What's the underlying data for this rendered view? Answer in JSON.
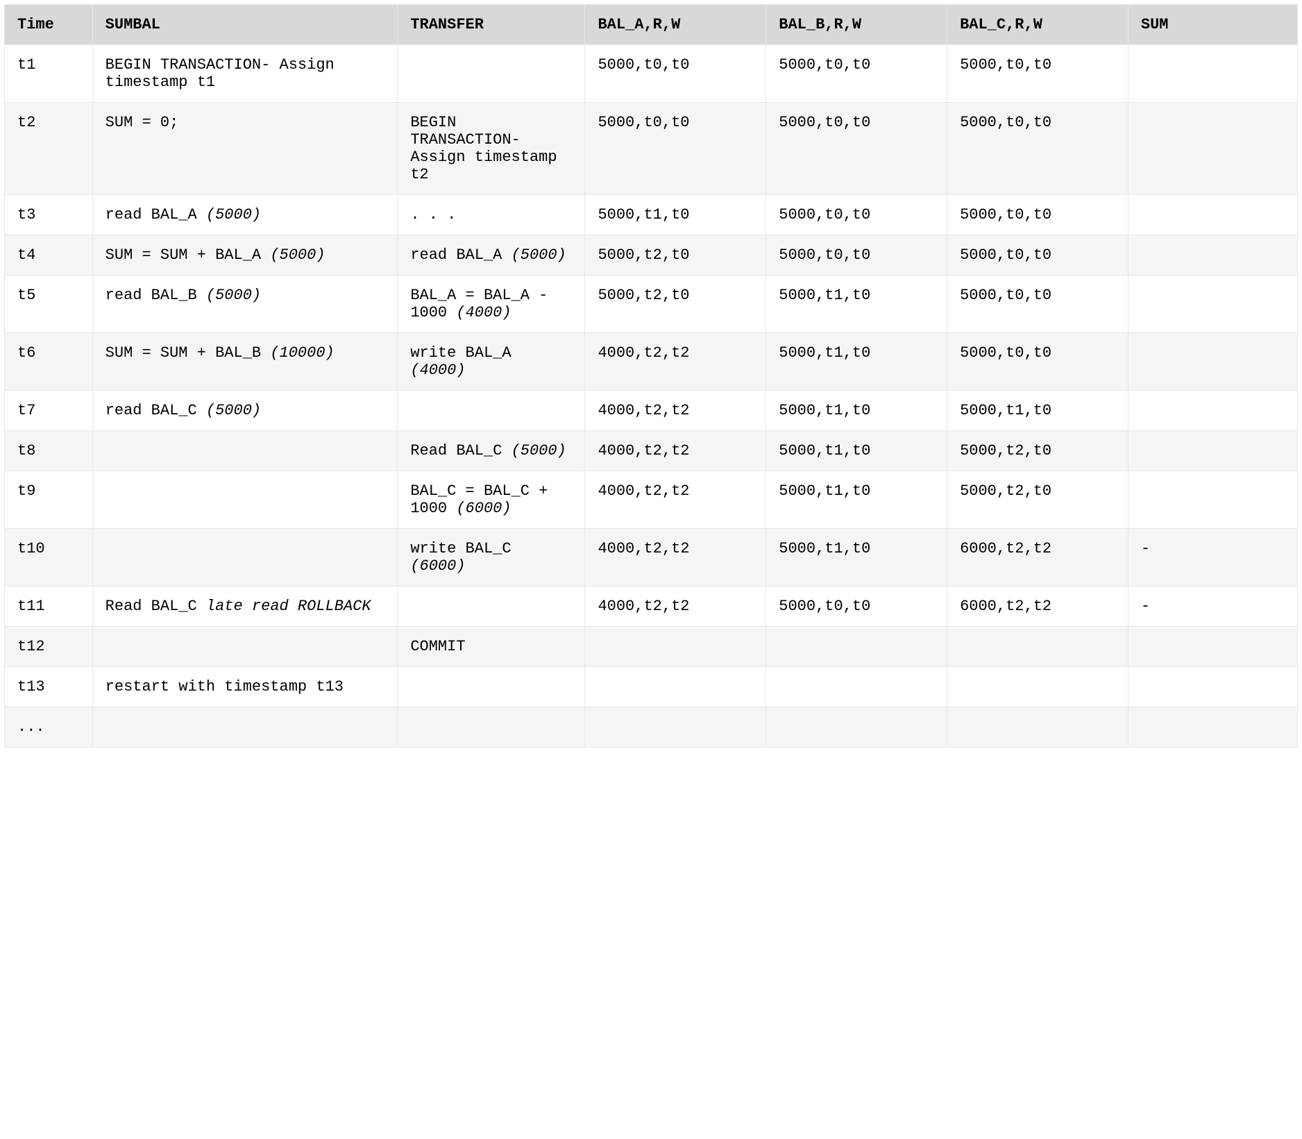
{
  "headers": [
    "Time",
    "SUMBAL",
    "TRANSFER",
    "BAL_A,R,W",
    "BAL_B,R,W",
    "BAL_C,R,W",
    "SUM"
  ],
  "rows": [
    {
      "time": "t1",
      "sumbal": [
        {
          "t": "BEGIN TRANSACTION- Assign timestamp t1",
          "i": false
        }
      ],
      "transfer": [],
      "bal_a": "5000,t0,t0",
      "bal_b": "5000,t0,t0",
      "bal_c": "5000,t0,t0",
      "sum": ""
    },
    {
      "time": "t2",
      "sumbal": [
        {
          "t": "SUM = 0;",
          "i": false
        }
      ],
      "transfer": [
        {
          "t": "BEGIN TRANSACTION- Assign timestamp t2",
          "i": false
        }
      ],
      "bal_a": "5000,t0,t0",
      "bal_b": "5000,t0,t0",
      "bal_c": "5000,t0,t0",
      "sum": ""
    },
    {
      "time": "t3",
      "sumbal": [
        {
          "t": "read BAL_A ",
          "i": false
        },
        {
          "t": "(5000)",
          "i": true
        }
      ],
      "transfer": [
        {
          "t": ". . .",
          "i": false
        }
      ],
      "bal_a": "5000,t1,t0",
      "bal_b": "5000,t0,t0",
      "bal_c": "5000,t0,t0",
      "sum": ""
    },
    {
      "time": "t4",
      "sumbal": [
        {
          "t": "SUM = SUM + BAL_A ",
          "i": false
        },
        {
          "t": "(5000)",
          "i": true
        }
      ],
      "transfer": [
        {
          "t": "read BAL_A ",
          "i": false
        },
        {
          "t": "(5000)",
          "i": true
        }
      ],
      "bal_a": "5000,t2,t0",
      "bal_b": "5000,t0,t0",
      "bal_c": "5000,t0,t0",
      "sum": ""
    },
    {
      "time": "t5",
      "sumbal": [
        {
          "t": "read BAL_B ",
          "i": false
        },
        {
          "t": "(5000)",
          "i": true
        }
      ],
      "transfer": [
        {
          "t": "BAL_A = BAL_A - 1000 ",
          "i": false
        },
        {
          "t": "(4000)",
          "i": true
        }
      ],
      "bal_a": "5000,t2,t0",
      "bal_b": "5000,t1,t0",
      "bal_c": "5000,t0,t0",
      "sum": ""
    },
    {
      "time": "t6",
      "sumbal": [
        {
          "t": "SUM = SUM + BAL_B ",
          "i": false
        },
        {
          "t": "(10000)",
          "i": true
        }
      ],
      "transfer": [
        {
          "t": "write BAL_A ",
          "i": false
        },
        {
          "t": "(4000)",
          "i": true
        }
      ],
      "bal_a": "4000,t2,t2",
      "bal_b": "5000,t1,t0",
      "bal_c": "5000,t0,t0",
      "sum": ""
    },
    {
      "time": "t7",
      "sumbal": [
        {
          "t": "read BAL_C ",
          "i": false
        },
        {
          "t": "(5000)",
          "i": true
        }
      ],
      "transfer": [],
      "bal_a": "4000,t2,t2",
      "bal_b": "5000,t1,t0",
      "bal_c": "5000,t1,t0",
      "sum": ""
    },
    {
      "time": "t8",
      "sumbal": [],
      "transfer": [
        {
          "t": "Read BAL_C ",
          "i": false
        },
        {
          "t": "(5000)",
          "i": true
        }
      ],
      "bal_a": "4000,t2,t2",
      "bal_b": "5000,t1,t0",
      "bal_c": "5000,t2,t0",
      "sum": ""
    },
    {
      "time": "t9",
      "sumbal": [],
      "transfer": [
        {
          "t": "BAL_C = BAL_C + 1000 ",
          "i": false
        },
        {
          "t": "(6000)",
          "i": true
        }
      ],
      "bal_a": "4000,t2,t2",
      "bal_b": "5000,t1,t0",
      "bal_c": "5000,t2,t0",
      "sum": ""
    },
    {
      "time": "t10",
      "sumbal": [],
      "transfer": [
        {
          "t": "write BAL_C ",
          "i": false
        },
        {
          "t": "(6000)",
          "i": true
        }
      ],
      "bal_a": "4000,t2,t2",
      "bal_b": "5000,t1,t0",
      "bal_c": "6000,t2,t2",
      "sum": "-"
    },
    {
      "time": "t11",
      "sumbal": [
        {
          "t": "Read BAL_C ",
          "i": false
        },
        {
          "t": "late read ROLLBACK",
          "i": true
        }
      ],
      "transfer": [],
      "bal_a": "4000,t2,t2",
      "bal_b": "5000,t0,t0",
      "bal_c": "6000,t2,t2",
      "sum": "-"
    },
    {
      "time": "t12",
      "sumbal": [],
      "transfer": [
        {
          "t": "COMMIT",
          "i": false
        }
      ],
      "bal_a": "",
      "bal_b": "",
      "bal_c": "",
      "sum": ""
    },
    {
      "time": "t13",
      "sumbal": [
        {
          "t": "restart with timestamp t13",
          "i": false
        }
      ],
      "transfer": [],
      "bal_a": "",
      "bal_b": "",
      "bal_c": "",
      "sum": ""
    },
    {
      "time": "...",
      "sumbal": [],
      "transfer": [],
      "bal_a": "",
      "bal_b": "",
      "bal_c": "",
      "sum": ""
    }
  ]
}
